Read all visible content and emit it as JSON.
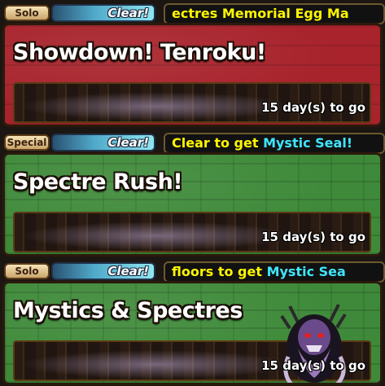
{
  "dungeons": [
    {
      "type_label": "Solo",
      "clear_label": "Clear!",
      "ribbon_yellow": "ectres Memorial Egg Ma",
      "ribbon_cyan": "",
      "title": "Showdown! Tenroku!",
      "timer": "15 day(s) to go",
      "plate_color": "#a8232c"
    },
    {
      "type_label": "Special",
      "clear_label": "Clear!",
      "ribbon_yellow": "Clear to get ",
      "ribbon_cyan": "Mystic Seal!",
      "title": "Spectre Rush!",
      "timer": "15 day(s) to go",
      "plate_color": "#3f8a3a"
    },
    {
      "type_label": "Solo",
      "clear_label": "Clear!",
      "ribbon_yellow": "floors to get ",
      "ribbon_cyan": "Mystic Sea",
      "title": "Mystics & Spectres",
      "timer": "15 day(s) to go",
      "plate_color": "#3f8a3a",
      "monster_icon": "spectre-monster-icon"
    }
  ]
}
